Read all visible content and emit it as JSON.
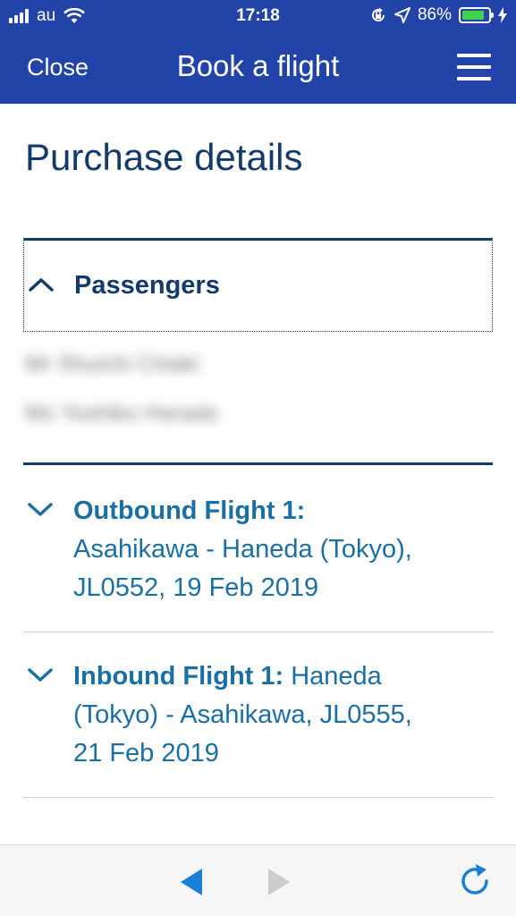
{
  "status_bar": {
    "carrier": "au",
    "time": "17:18",
    "battery": "86%",
    "battery_level": 0.86,
    "icons": [
      "signal-bars-icon",
      "wifi-icon",
      "rotation-lock-icon",
      "location-arrow-icon",
      "battery-icon",
      "charging-bolt-icon"
    ]
  },
  "nav": {
    "close_label": "Close",
    "title": "Book a flight",
    "menu_icon": "hamburger-menu-icon"
  },
  "page": {
    "title": "Purchase details"
  },
  "passengers": {
    "label": "Passengers",
    "expanded": true,
    "names": [
      "Mr Shuichi Chiaki",
      "Ms Yoshiko Harada"
    ]
  },
  "flights": [
    {
      "heading": "Outbound Flight 1:",
      "line1": "Asahikawa - Haneda (Tokyo),",
      "line2": "JL0552, 19 Feb 2019",
      "line3": ""
    },
    {
      "heading": "Inbound Flight 1:",
      "line1": " Haneda",
      "line2": "(Tokyo) - Asahikawa, JL0555,",
      "line3": "21 Feb 2019"
    }
  ],
  "colors": {
    "header_bg": "#2244a8",
    "title_navy": "#123a6c",
    "flight_blue": "#1a6fa3",
    "back_arrow": "#1a7fd8",
    "forward_arrow_disabled": "#cccccc"
  },
  "toolbar": {
    "back_icon": "back-arrow-icon",
    "forward_icon": "forward-arrow-icon",
    "reload_icon": "reload-icon"
  }
}
